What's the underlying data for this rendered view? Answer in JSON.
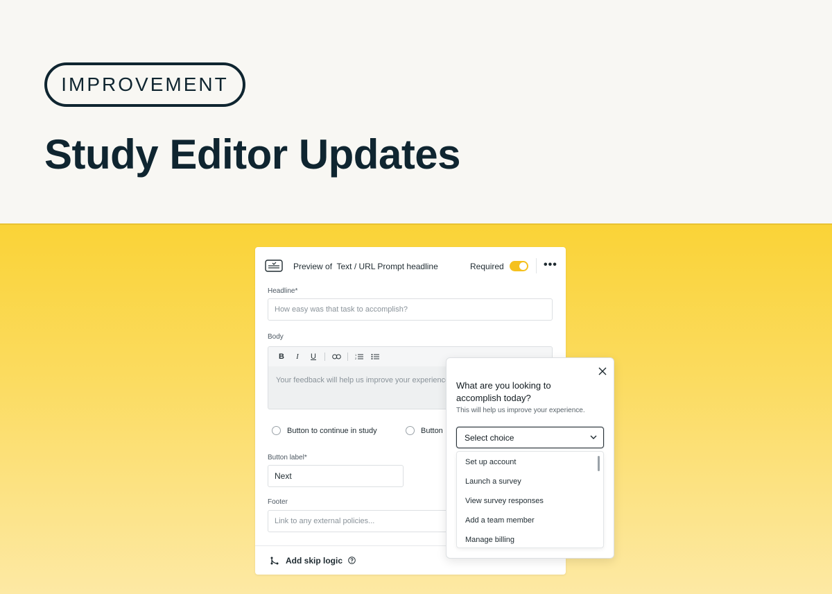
{
  "hero": {
    "tag": "IMPROVEMENT",
    "title": "Study Editor Updates"
  },
  "editor": {
    "header": {
      "title_prefix": "Preview of",
      "title_main": "Text / URL Prompt headline",
      "required_label": "Required",
      "required_on": true,
      "more": "•••"
    },
    "headline": {
      "label": "Headline*",
      "placeholder": "How easy was that task to accomplish?"
    },
    "body": {
      "label": "Body",
      "toolbar": {
        "bold": "B",
        "italic": "I",
        "underline": "U"
      },
      "placeholder": "Your feedback will help us improve your experience."
    },
    "radios": [
      {
        "label": "Button to continue in study"
      },
      {
        "label": "Button"
      }
    ],
    "button_label": {
      "label": "Button label*",
      "value": "Next"
    },
    "footer": {
      "label": "Footer",
      "placeholder": "Link to any external policies..."
    },
    "skip_logic": {
      "label": "Add skip logic"
    }
  },
  "popup": {
    "question": "What are you looking to accomplish today?",
    "subtext": "This will help us improve your experience.",
    "select": {
      "value": "Select choice"
    },
    "options": [
      "Set up account",
      "Launch a survey",
      "View survey responses",
      "Add a team member",
      "Manage billing"
    ]
  },
  "colors": {
    "ink": "#0f2530",
    "toggle": "#f5c11e",
    "yellow_top": "#fad337",
    "yellow_bottom": "#fde9a4",
    "background": "#f8f7f3"
  },
  "icons": [
    "prompt-icon",
    "more-icon",
    "bold-icon",
    "italic-icon",
    "underline-icon",
    "link-icon",
    "ordered-list-icon",
    "bullet-list-icon",
    "branch-icon",
    "help-icon",
    "close-icon",
    "chevron-down-icon"
  ]
}
